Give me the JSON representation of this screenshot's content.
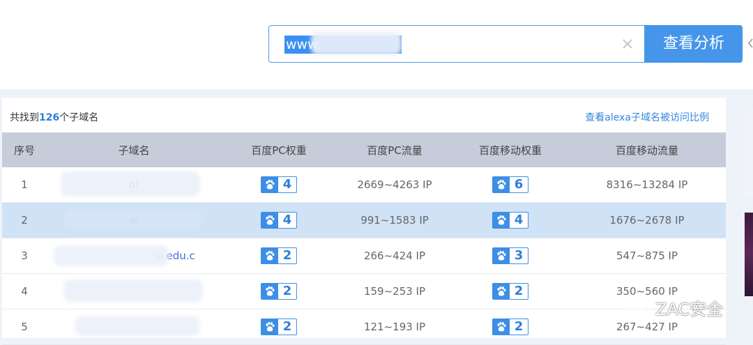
{
  "search": {
    "value": "www.",
    "button_label": "查看分析"
  },
  "results": {
    "count_prefix": "共找到",
    "count": "126",
    "count_suffix": "个子域名",
    "alexa_link": "查看alexa子域名被访问比例"
  },
  "table": {
    "headers": [
      "序号",
      "子域名",
      "百度PC权重",
      "百度PC流量",
      "百度移动权重",
      "百度移动流量"
    ],
    "rows": [
      {
        "index": "1",
        "domain": "bf",
        "pc_weight": "4",
        "pc_traffic": "2669~4263 IP",
        "mobile_weight": "6",
        "mobile_traffic": "8316~13284 IP"
      },
      {
        "index": "2",
        "domain": "w",
        "pc_weight": "4",
        "pc_traffic": "991~1583 IP",
        "mobile_weight": "4",
        "mobile_traffic": "1676~2678 IP"
      },
      {
        "index": "3",
        "domain": "u.edu.c",
        "pc_weight": "2",
        "pc_traffic": "266~424 IP",
        "mobile_weight": "3",
        "mobile_traffic": "547~875 IP"
      },
      {
        "index": "4",
        "domain": "",
        "pc_weight": "2",
        "pc_traffic": "159~253 IP",
        "mobile_weight": "2",
        "mobile_traffic": "350~560 IP"
      },
      {
        "index": "5",
        "domain": "",
        "pc_weight": "2",
        "pc_traffic": "121~193 IP",
        "mobile_weight": "2",
        "mobile_traffic": "267~427 IP"
      }
    ]
  },
  "watermark": {
    "text": "ZAC安全"
  },
  "colors": {
    "accent": "#4596ea",
    "highlight_row": "#cfe2f6",
    "header_bg": "#c6ccda"
  }
}
